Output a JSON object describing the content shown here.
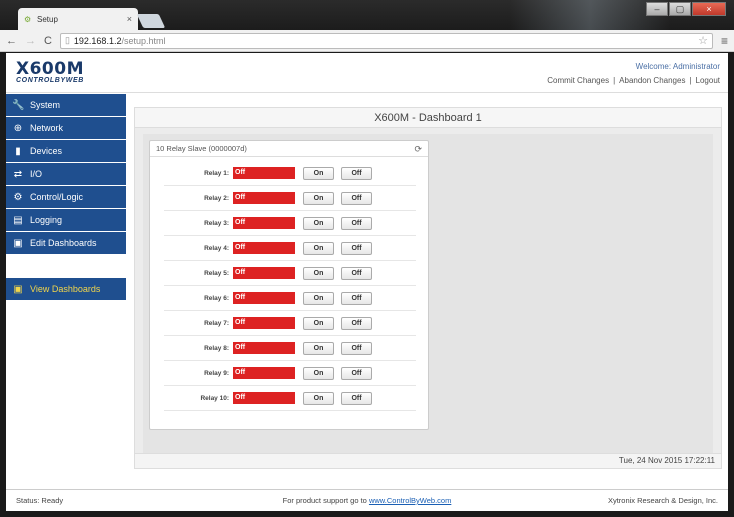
{
  "browser": {
    "tab_title": "Setup",
    "tab_close": "×",
    "url_host": "192.168.1.2",
    "url_path": "/setup.html",
    "nav_back": "←",
    "nav_forward": "→",
    "nav_reload": "C",
    "window_buttons": [
      "–",
      "▢",
      "×"
    ]
  },
  "header": {
    "logo_main": "X600M",
    "logo_sub": "CONTROLBYWEB",
    "welcome": "Welcome: Administrator",
    "commit": "Commit Changes",
    "abandon": "Abandon Changes",
    "logout": "Logout",
    "sep": "|"
  },
  "sidebar": {
    "items": [
      {
        "label": "System",
        "icon": "wrench-icon",
        "glyph": "🔧"
      },
      {
        "label": "Network",
        "icon": "globe-icon",
        "glyph": "⊕"
      },
      {
        "label": "Devices",
        "icon": "device-icon",
        "glyph": "▮"
      },
      {
        "label": "I/O",
        "icon": "arrows-icon",
        "glyph": "⇄"
      },
      {
        "label": "Control/Logic",
        "icon": "logic-icon",
        "glyph": "⚙"
      },
      {
        "label": "Logging",
        "icon": "log-icon",
        "glyph": "▤"
      },
      {
        "label": "Edit Dashboards",
        "icon": "dashboard-icon",
        "glyph": "▣"
      }
    ],
    "view_dashboards": {
      "label": "View Dashboards",
      "icon": "dashboard-icon",
      "glyph": "▣"
    }
  },
  "main": {
    "title": "X600M - Dashboard 1",
    "widget": {
      "title": "10 Relay Slave (0000007d)",
      "refresh_glyph": "⟳",
      "on_label": "On",
      "off_label": "Off",
      "relays": [
        {
          "label": "Relay 1:",
          "state": "Off"
        },
        {
          "label": "Relay 2:",
          "state": "Off"
        },
        {
          "label": "Relay 3:",
          "state": "Off"
        },
        {
          "label": "Relay 4:",
          "state": "Off"
        },
        {
          "label": "Relay 5:",
          "state": "Off"
        },
        {
          "label": "Relay 6:",
          "state": "Off"
        },
        {
          "label": "Relay 7:",
          "state": "Off"
        },
        {
          "label": "Relay 8:",
          "state": "Off"
        },
        {
          "label": "Relay 9:",
          "state": "Off"
        },
        {
          "label": "Relay 10:",
          "state": "Off"
        }
      ]
    },
    "datetime": "Tue, 24 Nov 2015 17:22:11"
  },
  "footer": {
    "status": "Status:  Ready",
    "support_text": "For product support go to",
    "support_link": "www.ControlByWeb.com",
    "company": "Xytronix Research & Design, Inc."
  },
  "colors": {
    "sidebar_bg": "#1f4f8f",
    "active_text": "#f2d64b",
    "relay_off": "#dd2222"
  }
}
